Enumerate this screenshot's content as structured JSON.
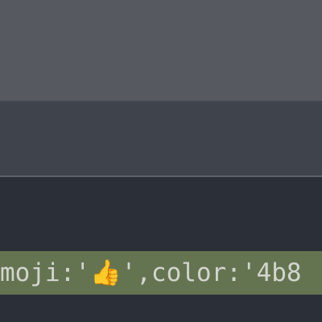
{
  "editor": {
    "highlighted_line": {
      "text": "moji:'👍',color:'4b8"
    }
  },
  "colors": {
    "top_band": "#565960",
    "middle_band": "#3f434b",
    "editor_background": "#2b2f38",
    "line_highlight": "#657450",
    "code_text": "#d3d5cf"
  }
}
